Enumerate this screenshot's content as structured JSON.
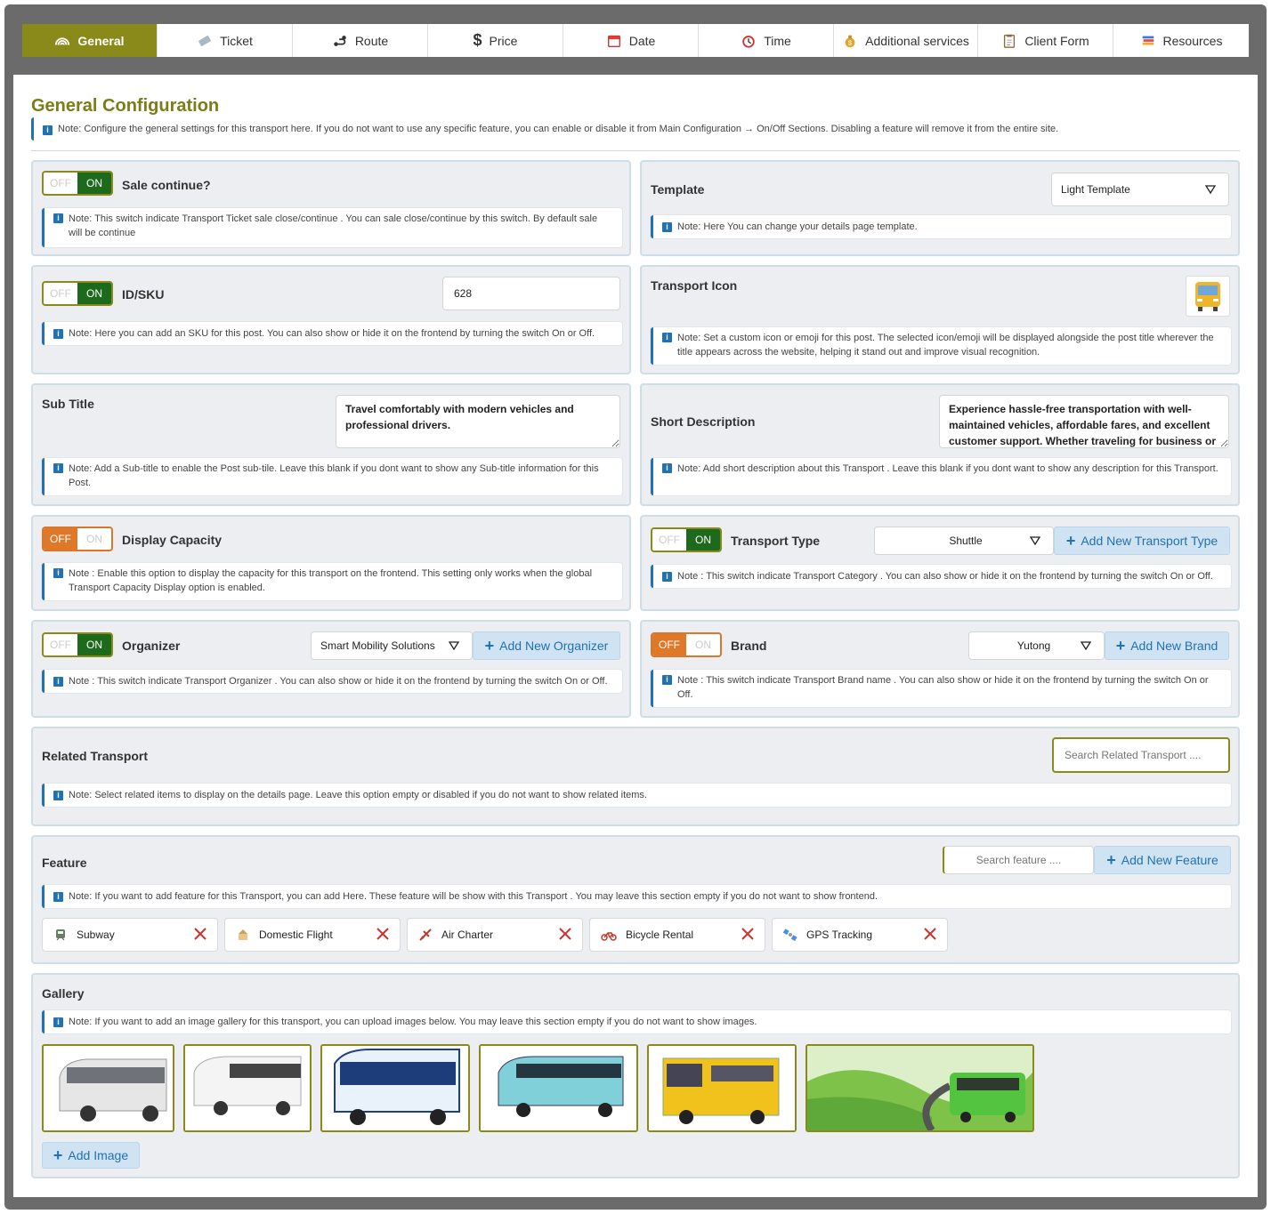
{
  "tabs": [
    {
      "label": "General",
      "icon": "rainbow-icon"
    },
    {
      "label": "Ticket",
      "icon": "ticket-icon"
    },
    {
      "label": "Route",
      "icon": "route-icon"
    },
    {
      "label": "Price",
      "icon": "dollar-icon"
    },
    {
      "label": "Date",
      "icon": "calendar-icon"
    },
    {
      "label": "Time",
      "icon": "alarm-clock-icon"
    },
    {
      "label": "Additional services",
      "icon": "money-bag-icon"
    },
    {
      "label": "Client Form",
      "icon": "clipboard-icon"
    },
    {
      "label": "Resources",
      "icon": "books-icon"
    }
  ],
  "header": {
    "title": "General Configuration",
    "note": "Note: Configure the general settings for this transport here. If you do not want to use any specific feature, you can enable or disable it from Main Configuration → On/Off Sections. Disabling a feature will remove it from the entire site."
  },
  "switch": {
    "off": "OFF",
    "on": "ON"
  },
  "sale": {
    "label": "Sale continue?",
    "state": "on",
    "note": "Note: This switch indicate Transport Ticket sale close/continue . You can sale close/continue by this switch. By default sale will be continue"
  },
  "template": {
    "label": "Template",
    "value": "Light Template",
    "note": "Note: Here You can change your details page template."
  },
  "sku": {
    "label": "ID/SKU",
    "state": "on",
    "value": "628",
    "note": "Note: Here you can add an SKU for this post. You can also show or hide it on the frontend by turning the switch On or Off."
  },
  "transport_icon": {
    "label": "Transport Icon",
    "icon": "bus-icon",
    "note": "Note: Set a custom icon or emoji for this post. The selected icon/emoji will be displayed alongside the post title wherever the title appears across the website, helping it stand out and improve visual recognition."
  },
  "subtitle": {
    "label": "Sub Title",
    "value": "Travel comfortably with modern vehicles and professional drivers.",
    "note": "Note: Add a Sub-title to enable the Post sub-tile. Leave this blank if you dont want to show any Sub-title information for this Post."
  },
  "short_desc": {
    "label": "Short Description",
    "value": "Experience hassle-free transportation with well-maintained vehicles, affordable fares, and excellent customer support. Whether traveling for business or",
    "note": "Note: Add short description about this Transport . Leave this blank if you dont want to show any description for this Transport."
  },
  "capacity": {
    "label": "Display Capacity",
    "state": "off",
    "note": "Note : Enable this option to display the capacity for this transport on the frontend. This setting only works when the global Transport Capacity Display option is enabled."
  },
  "transport_type": {
    "label": "Transport Type",
    "state": "on",
    "value": "Shuttle",
    "add_label": "Add New Transport Type",
    "note": "Note : This switch indicate Transport Category . You can also show or hide it on the frontend by turning the switch On or Off."
  },
  "organizer": {
    "label": "Organizer",
    "state": "on",
    "value": "Smart Mobility Solutions",
    "add_label": "Add New Organizer",
    "note": "Note : This switch indicate Transport Organizer . You can also show or hide it on the frontend by turning the switch On or Off."
  },
  "brand": {
    "label": "Brand",
    "state": "off",
    "value": "Yutong",
    "add_label": "Add New Brand",
    "note": "Note : This switch indicate Transport Brand name . You can also show or hide it on the frontend by turning the switch On or Off."
  },
  "related": {
    "label": "Related Transport",
    "placeholder": "Search Related Transport ....",
    "note": "Note: Select related items to display on the details page. Leave this option empty or disabled if you do not want to show related items."
  },
  "feature": {
    "label": "Feature",
    "placeholder": "Search feature ....",
    "add_label": "Add New Feature",
    "note": "Note: If you want to add feature for this Transport, you can add Here. These feature will be show with this Transport . You may leave this section empty if you do not want to show frontend.",
    "items": [
      {
        "label": "Subway",
        "icon": "metro-icon"
      },
      {
        "label": "Domestic Flight",
        "icon": "airport-icon"
      },
      {
        "label": "Air Charter",
        "icon": "plane-icon"
      },
      {
        "label": "Bicycle Rental",
        "icon": "bicycle-icon"
      },
      {
        "label": "GPS Tracking",
        "icon": "satellite-icon"
      }
    ]
  },
  "gallery": {
    "label": "Gallery",
    "note": "Note: If you want to add an image gallery for this transport, you can upload images below. You may leave this section empty if you do not want to show images.",
    "images": [
      {
        "icon": "bus-photo-icon",
        "color": "#e8e8e8"
      },
      {
        "icon": "bus-photo-icon",
        "color": "#f2f2f2"
      },
      {
        "icon": "bus-photo-icon",
        "color": "#dfeefa"
      },
      {
        "icon": "bus-photo-icon",
        "color": "#7fd0d8"
      },
      {
        "icon": "bus-photo-icon",
        "color": "#f0c21c"
      },
      {
        "icon": "bus-photo-icon",
        "color": "#53c43f"
      }
    ],
    "add_label": "Add Image"
  },
  "colors": {
    "accent": "#8a8a1a",
    "on": "#1d6a1d",
    "off": "#e0782a",
    "link": "#2271b1"
  }
}
